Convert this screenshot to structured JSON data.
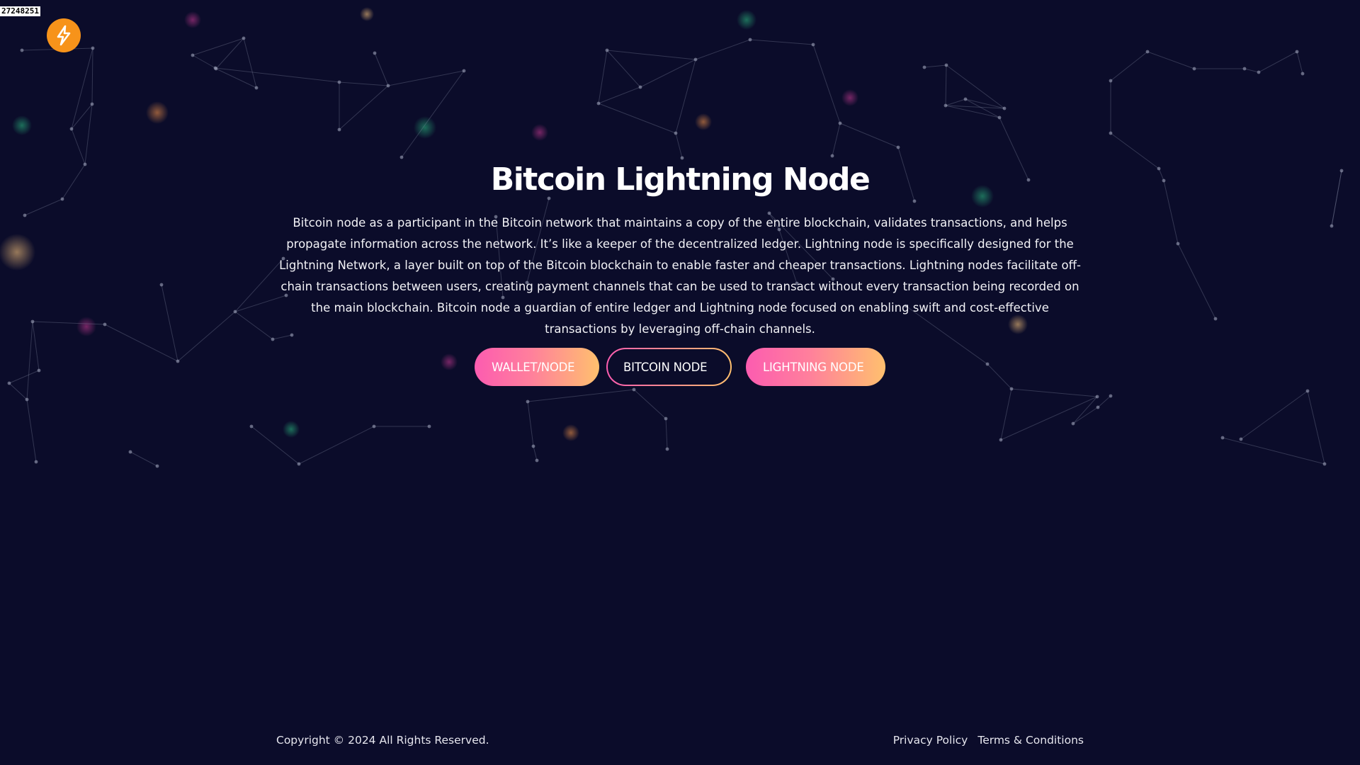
{
  "counter": "27248251",
  "logo": {
    "icon": "lightning-bolt-icon",
    "color": "#f7931a"
  },
  "hero": {
    "title": "Bitcoin Lightning Node",
    "description": "Bitcoin node as a participant in the Bitcoin network that maintains a copy of the entire blockchain, validates transactions, and helps propagate information across the network. It’s like a keeper of the decentralized ledger. Lightning node is specifically designed for the Lightning Network, a layer built on top of the Bitcoin blockchain to enable faster and cheaper transactions. Lightning nodes facilitate off-chain transactions between users, creating payment channels that can be used to transact without every transaction being recorded on the main blockchain. Bitcoin node a guardian of entire ledger and Lightning node focused on enabling swift and cost-effective transactions by leveraging off-chain channels."
  },
  "buttons": {
    "wallet": "WALLET/NODE",
    "bitcoin": "BITCOIN NODE",
    "lightning": "LIGHTNING NODE"
  },
  "footer": {
    "copyright": "Copyright © 2024 All Rights Reserved.",
    "privacy": "Privacy Policy",
    "terms": "Terms & Conditions"
  },
  "colors": {
    "background": "#0b0c2a",
    "accent_orange": "#f7931a",
    "gradient_start": "#fc5cb0",
    "gradient_end": "#ffc06e"
  }
}
